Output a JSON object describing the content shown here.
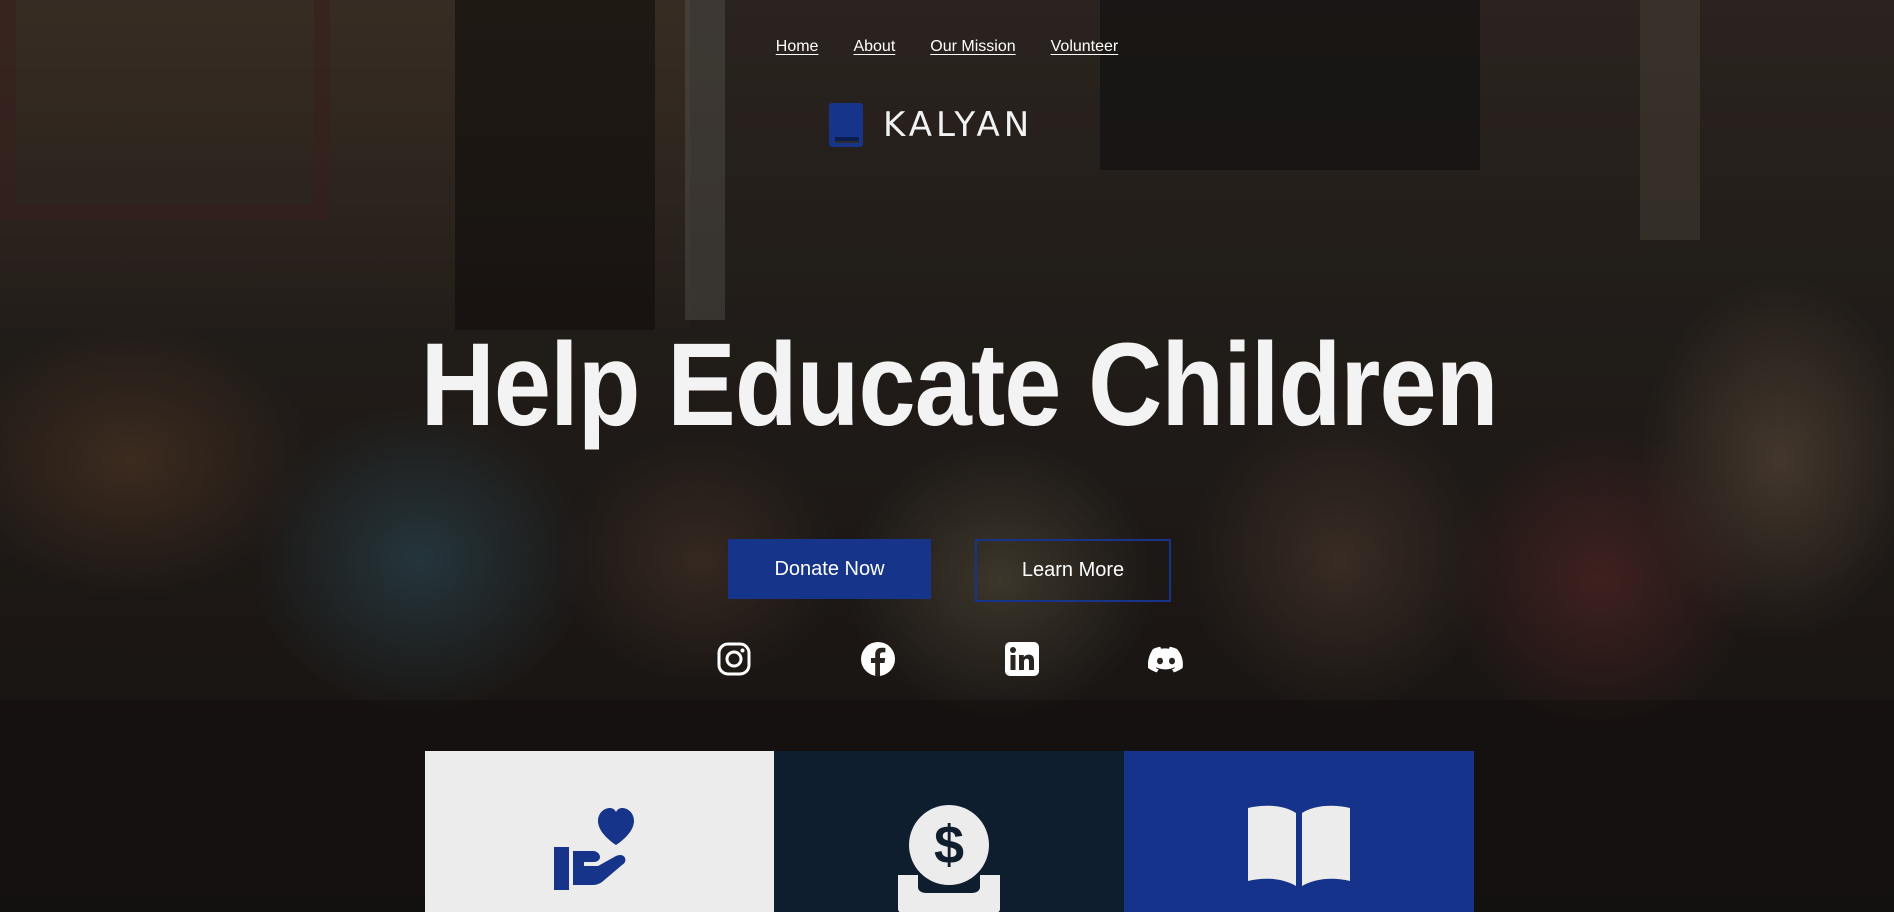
{
  "nav": {
    "items": [
      {
        "label": "Home"
      },
      {
        "label": "About"
      },
      {
        "label": "Our Mission"
      },
      {
        "label": "Volunteer"
      }
    ]
  },
  "logo": {
    "text": "KALYAN",
    "icon": "book-icon"
  },
  "hero": {
    "headline": "Help Educate Children"
  },
  "buttons": {
    "donate_label": "Donate Now",
    "learn_label": "Learn More"
  },
  "social": [
    "instagram-icon",
    "facebook-icon",
    "linkedin-icon",
    "discord-icon"
  ],
  "cards": [
    {
      "icon": "heart-hand-icon",
      "bg": "#ececec"
    },
    {
      "icon": "donation-coin-icon",
      "bg": "#0f1e2e"
    },
    {
      "icon": "open-book-icon",
      "bg": "#15338b"
    }
  ],
  "colors": {
    "brand": "#16348a",
    "dark": "#0f1e2e",
    "light": "#ececec"
  }
}
